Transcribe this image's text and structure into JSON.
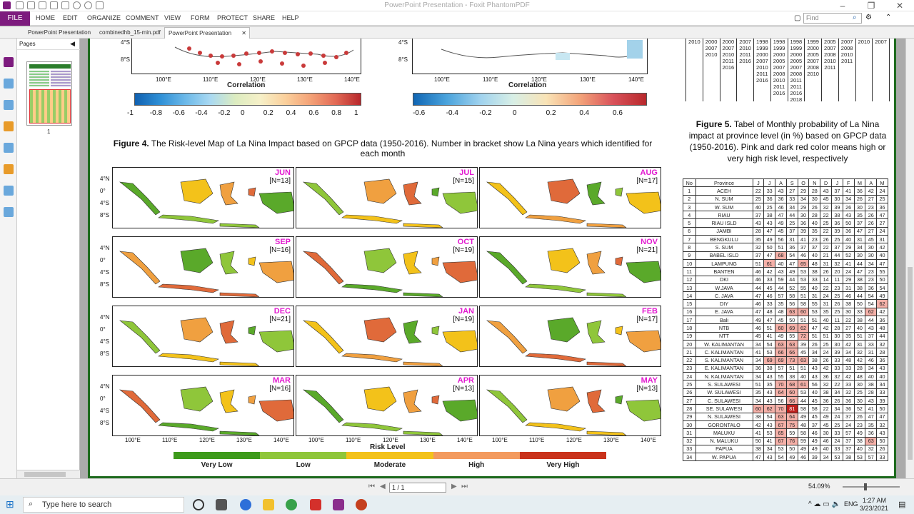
{
  "window": {
    "title": "PowerPoint Presentation - Foxit PhantomPDF"
  },
  "menu": {
    "file": "FILE",
    "items": [
      "HOME",
      "EDIT",
      "ORGANIZE",
      "COMMENT",
      "VIEW",
      "FORM",
      "PROTECT",
      "SHARE",
      "HELP"
    ],
    "find_placeholder": "Find"
  },
  "tabs": [
    "PowerPoint Presentation",
    "combinedhb_15-min.pdf",
    "PowerPoint Presentation"
  ],
  "pages_panel": {
    "title": "Pages",
    "thumb_label": "1"
  },
  "figure4": {
    "top_ticks_left": [
      "100°E",
      "110°E",
      "120°E",
      "130°E",
      "140°E"
    ],
    "top_lat": [
      "4°S",
      "8°S"
    ],
    "corr_label": "Correlation",
    "cbar1_ticks": [
      "-1",
      "-0.8",
      "-0.6",
      "-0.4",
      "-0.2",
      "0",
      "0.2",
      "0.4",
      "0.6",
      "0.8",
      "1"
    ],
    "cbar2_ticks": [
      "-0.6",
      "-0.4",
      "-0.2",
      "0",
      "0.2",
      "0.4",
      "0.6"
    ],
    "caption_bold": "Figure 4.",
    "caption": "The Risk-level Map of La Nina Impact based on GPCP data (1950-2016). Number in bracket show La Nina years which identified for each month",
    "months": [
      [
        "JUN",
        "[N=13]"
      ],
      [
        "JUL",
        "[N=15]"
      ],
      [
        "AUG",
        "[N=17]"
      ],
      [
        "SEP",
        "[N=16]"
      ],
      [
        "OCT",
        "[N=19]"
      ],
      [
        "NOV",
        "[N=21]"
      ],
      [
        "DEC",
        "[N=21]"
      ],
      [
        "JAN",
        "[N=19]"
      ],
      [
        "FEB",
        "[N=17]"
      ],
      [
        "MAR",
        "[N=16]"
      ],
      [
        "APR",
        "[N=13]"
      ],
      [
        "MAY",
        "[N=13]"
      ]
    ],
    "lat_labels": [
      "4°N",
      "0°",
      "4°S",
      "8°S"
    ],
    "lon_labels": [
      "100°E",
      "110°E",
      "120°E",
      "130°E",
      "140°E"
    ],
    "risk_title": "Risk Level",
    "risk_levels": [
      {
        "label": "Very Low",
        "color": "#3d9a1b"
      },
      {
        "label": "Low",
        "color": "#8fc63a"
      },
      {
        "label": "Moderate",
        "color": "#f3c21a"
      },
      {
        "label": "High",
        "color": "#f39a5e"
      },
      {
        "label": "Very High",
        "color": "#c9321b"
      }
    ]
  },
  "years_table": {
    "rows": [
      [
        "2010",
        "2000",
        "2000",
        "2007",
        "1998",
        "1998",
        "1998",
        "1999",
        "2005",
        "2007",
        "2010",
        "2007"
      ],
      [
        "",
        "2007",
        "2007",
        "2010",
        "1999",
        "1999",
        "1999",
        "2000",
        "2007",
        "2008",
        "",
        ""
      ],
      [
        "",
        "2010",
        "2010",
        "2011",
        "2000",
        "2000",
        "2000",
        "2005",
        "2008",
        "2010",
        "",
        ""
      ],
      [
        "",
        "",
        "2011",
        "2016",
        "2007",
        "2005",
        "2005",
        "2007",
        "2010",
        "2011",
        "",
        ""
      ],
      [
        "",
        "",
        "2016",
        "",
        "2010",
        "2007",
        "2007",
        "2008",
        "2011",
        "",
        "",
        ""
      ],
      [
        "",
        "",
        "",
        "",
        "2011",
        "2008",
        "2008",
        "2010",
        "",
        "",
        "",
        ""
      ],
      [
        "",
        "",
        "",
        "",
        "2016",
        "2010",
        "2011",
        "",
        "",
        "",
        "",
        ""
      ],
      [
        "",
        "",
        "",
        "",
        "",
        "2011",
        "2011",
        "",
        "",
        "",
        "",
        ""
      ],
      [
        "",
        "",
        "",
        "",
        "",
        "2016",
        "2016",
        "",
        "",
        "",
        "",
        ""
      ],
      [
        "",
        "",
        "",
        "",
        "",
        "",
        "2018",
        "",
        "",
        "",
        "",
        ""
      ]
    ],
    "totals": [
      "13",
      "15",
      "17",
      "16",
      "19",
      "21",
      "21",
      "19",
      "17",
      "16",
      "13",
      "13"
    ]
  },
  "figure5": {
    "caption_bold": "Figure 5.",
    "caption": "Tabel of Monthly probability of La Nina impact at province level (in %) based on GPCP data (1950-2016). Pink and dark red color means high or very high risk level, respectively"
  },
  "prob_table": {
    "headers": [
      "No",
      "Province",
      "J",
      "J",
      "A",
      "S",
      "O",
      "N",
      "D",
      "J",
      "F",
      "M",
      "A",
      "M"
    ],
    "rows": [
      [
        "1",
        "ACEH",
        "22",
        "33",
        "43",
        "27",
        "29",
        "28",
        "43",
        "37",
        "41",
        "36",
        "42",
        "24"
      ],
      [
        "2",
        "N. SUM",
        "25",
        "36",
        "36",
        "33",
        "34",
        "30",
        "45",
        "30",
        "34",
        "26",
        "27",
        "25"
      ],
      [
        "3",
        "W. SUM",
        "40",
        "25",
        "46",
        "34",
        "29",
        "26",
        "32",
        "39",
        "26",
        "30",
        "23",
        "36"
      ],
      [
        "4",
        "RIAU",
        "37",
        "38",
        "47",
        "44",
        "30",
        "28",
        "22",
        "38",
        "43",
        "35",
        "26",
        "47"
      ],
      [
        "5",
        "RIAU ISLD",
        "43",
        "43",
        "49",
        "25",
        "36",
        "40",
        "25",
        "36",
        "50",
        "37",
        "26",
        "27"
      ],
      [
        "6",
        "JAMBI",
        "28",
        "47",
        "45",
        "37",
        "39",
        "35",
        "22",
        "39",
        "36",
        "47",
        "27",
        "24"
      ],
      [
        "7",
        "BENGKULU",
        "35",
        "49",
        "56",
        "31",
        "41",
        "23",
        "26",
        "25",
        "40",
        "31",
        "45",
        "31"
      ],
      [
        "8",
        "S. SUM",
        "32",
        "50",
        "51",
        "36",
        "37",
        "37",
        "22",
        "37",
        "29",
        "34",
        "30",
        "42"
      ],
      [
        "9",
        "BABEL ISLD",
        "37",
        "47",
        "68",
        "54",
        "46",
        "40",
        "21",
        "44",
        "52",
        "30",
        "30",
        "40"
      ],
      [
        "10",
        "LAMPUNG",
        "51",
        "61",
        "40",
        "47",
        "65",
        "48",
        "31",
        "32",
        "41",
        "44",
        "34",
        "47"
      ],
      [
        "11",
        "BANTEN",
        "46",
        "42",
        "43",
        "49",
        "53",
        "38",
        "26",
        "20",
        "24",
        "47",
        "23",
        "55"
      ],
      [
        "12",
        "DKI",
        "46",
        "33",
        "59",
        "44",
        "53",
        "33",
        "14",
        "11",
        "29",
        "38",
        "23",
        "50"
      ],
      [
        "13",
        "W.JAVA",
        "44",
        "45",
        "44",
        "52",
        "55",
        "40",
        "22",
        "23",
        "31",
        "38",
        "36",
        "54"
      ],
      [
        "14",
        "C. JAVA",
        "47",
        "46",
        "57",
        "58",
        "51",
        "31",
        "24",
        "25",
        "46",
        "44",
        "54",
        "49"
      ],
      [
        "15",
        "DIY",
        "46",
        "33",
        "35",
        "56",
        "58",
        "55",
        "31",
        "26",
        "38",
        "50",
        "54",
        "62"
      ],
      [
        "16",
        "E. JAVA",
        "47",
        "48",
        "48",
        "63",
        "60",
        "53",
        "35",
        "25",
        "30",
        "33",
        "62",
        "42"
      ],
      [
        "17",
        "Bali",
        "49",
        "47",
        "45",
        "50",
        "51",
        "51",
        "40",
        "11",
        "22",
        "38",
        "44",
        "36"
      ],
      [
        "18",
        "NTB",
        "46",
        "51",
        "60",
        "69",
        "62",
        "47",
        "42",
        "28",
        "27",
        "40",
        "43",
        "48"
      ],
      [
        "19",
        "NTT",
        "45",
        "41",
        "49",
        "55",
        "72",
        "51",
        "51",
        "30",
        "35",
        "51",
        "37",
        "44"
      ],
      [
        "20",
        "W. KALIMANTAN",
        "34",
        "54",
        "63",
        "63",
        "39",
        "26",
        "25",
        "30",
        "42",
        "31",
        "33",
        "32"
      ],
      [
        "21",
        "C. KALIMANTAN",
        "41",
        "53",
        "66",
        "66",
        "45",
        "34",
        "24",
        "39",
        "34",
        "32",
        "31",
        "28"
      ],
      [
        "22",
        "S. KALIMANTAN",
        "34",
        "69",
        "69",
        "73",
        "63",
        "38",
        "26",
        "33",
        "48",
        "42",
        "46",
        "36"
      ],
      [
        "23",
        "E. KALIMANTAN",
        "36",
        "38",
        "57",
        "51",
        "51",
        "43",
        "42",
        "33",
        "33",
        "28",
        "34",
        "43"
      ],
      [
        "24",
        "N. KALIMANTAN",
        "34",
        "43",
        "55",
        "38",
        "40",
        "43",
        "36",
        "32",
        "42",
        "48",
        "40",
        "40"
      ],
      [
        "25",
        "S. SULAWESI",
        "51",
        "35",
        "70",
        "68",
        "61",
        "56",
        "32",
        "22",
        "33",
        "30",
        "38",
        "34"
      ],
      [
        "26",
        "W. SULAWESI",
        "35",
        "43",
        "64",
        "60",
        "53",
        "40",
        "38",
        "34",
        "32",
        "25",
        "28",
        "33"
      ],
      [
        "27",
        "C. SULAWESI",
        "34",
        "43",
        "56",
        "66",
        "44",
        "45",
        "36",
        "26",
        "36",
        "30",
        "43",
        "39"
      ],
      [
        "28",
        "SE. SULAWESI",
        "60",
        "62",
        "70",
        "81",
        "58",
        "58",
        "22",
        "34",
        "36",
        "52",
        "41",
        "50"
      ],
      [
        "29",
        "N. SULAWESI",
        "38",
        "54",
        "63",
        "64",
        "49",
        "45",
        "49",
        "24",
        "37",
        "26",
        "47",
        "47"
      ],
      [
        "30",
        "GORONTALO",
        "42",
        "43",
        "67",
        "75",
        "48",
        "37",
        "45",
        "25",
        "24",
        "23",
        "35",
        "32"
      ],
      [
        "31",
        "MALUKU",
        "41",
        "53",
        "65",
        "59",
        "58",
        "46",
        "30",
        "33",
        "57",
        "49",
        "36",
        "43"
      ],
      [
        "32",
        "N. MALUKU",
        "50",
        "41",
        "67",
        "76",
        "59",
        "49",
        "46",
        "24",
        "37",
        "38",
        "63",
        "50"
      ],
      [
        "33",
        "PAPUA",
        "38",
        "34",
        "53",
        "50",
        "49",
        "49",
        "40",
        "33",
        "37",
        "40",
        "32",
        "26"
      ],
      [
        "34",
        "W. PAPUA",
        "47",
        "43",
        "54",
        "49",
        "46",
        "39",
        "34",
        "53",
        "38",
        "53",
        "57",
        "33"
      ]
    ]
  },
  "status": {
    "page_indicator": "1 / 1",
    "zoom": "54.09%"
  },
  "taskbar": {
    "search": "Type here to search",
    "lang": "ENG",
    "time": "1:27 AM",
    "date": "3/23/2021"
  }
}
